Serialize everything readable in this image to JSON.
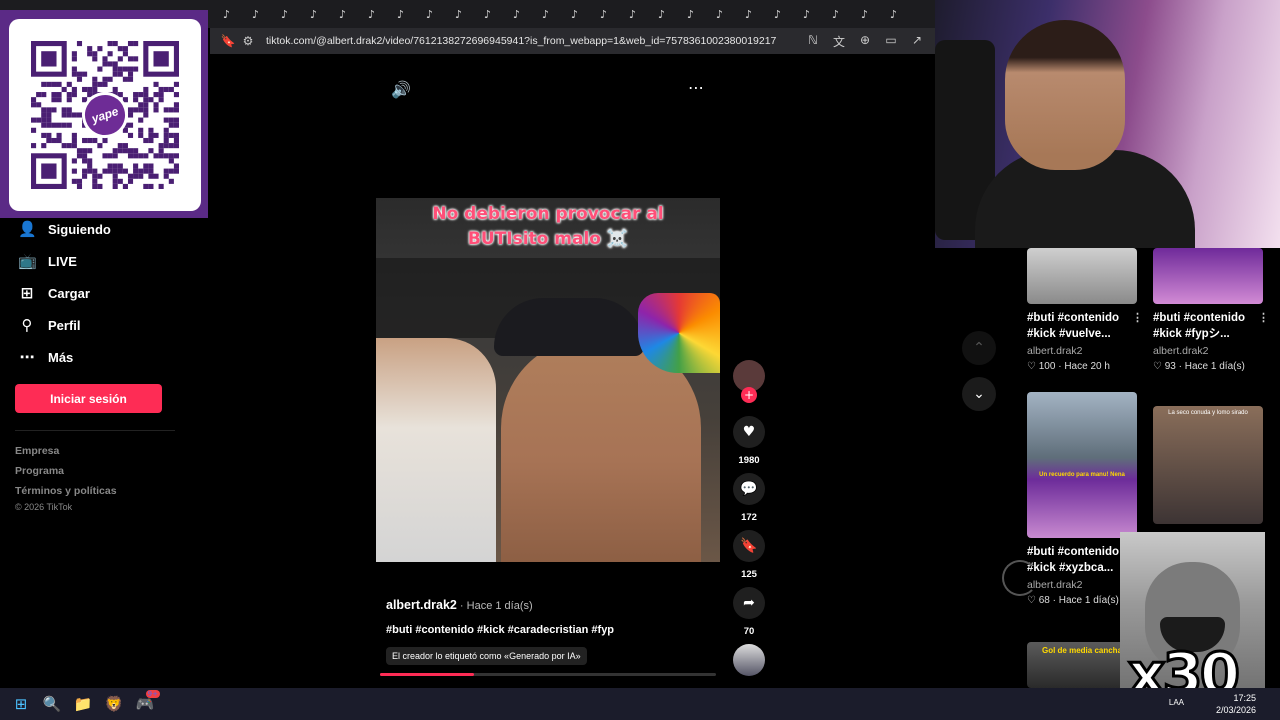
{
  "browser": {
    "url": "tiktok.com/@albert.drak2/video/7612138272696945941?is_from_webapp=1&web_id=7578361002380019217",
    "tab_icon": "tiktok-icon",
    "tab_count": 24
  },
  "qr": {
    "brand": "yape",
    "logo_currency": "S/"
  },
  "sidebar": {
    "items": [
      {
        "label": "Siguiendo",
        "icon": "following-icon"
      },
      {
        "label": "LIVE",
        "icon": "live-tv-icon"
      },
      {
        "label": "Cargar",
        "icon": "upload-plus-icon"
      },
      {
        "label": "Perfil",
        "icon": "profile-icon"
      },
      {
        "label": "Más",
        "icon": "more-dots-icon"
      }
    ],
    "login_button": "Iniciar sesión",
    "footer_links": [
      "Empresa",
      "Programa",
      "Términos y políticas"
    ],
    "copyright": "© 2026 TikTok"
  },
  "video": {
    "caption_line1": "No debieron provocar al",
    "caption_line2": "BUTIsito malo ☠️",
    "author": "albert.drak2",
    "time": " · Hace 1 día(s)",
    "hashtags": "#buti #contenido #kick #caradecristian #fyp",
    "ai_label": "El creador lo etiquetó como «Generado por IA»",
    "progress_fraction": 0.28,
    "likes": "1980",
    "comments": "172",
    "saves": "125",
    "shares": "70"
  },
  "recommendations": [
    {
      "title_line1": "#buti #contenido",
      "title_line2": "#kick #vuelve...",
      "author": "albert.drak2",
      "likes": "100",
      "time": "Hace 20 h"
    },
    {
      "title_line1": "#buti #contenido",
      "title_line2": "#kick #fypシ...",
      "author": "albert.drak2",
      "likes": "93",
      "time": "Hace 1 día(s)"
    },
    {
      "title_line1": "#buti #contenido",
      "title_line2": "#kick #xyzbca...",
      "author": "albert.drak2",
      "likes": "68",
      "time": "Hace 1 día(s)"
    },
    {
      "thumb_text": "Gol de media cancha"
    }
  ],
  "thumb_texts": {
    "card3_banner": "Un recuerdo para manu! Nena",
    "card4_banner": "La seco conuda y lomo sirado"
  },
  "meme": {
    "text": "x30"
  },
  "taskbar": {
    "time": "17:25",
    "date": "2/03/2026",
    "lang": "LAA",
    "discord_badge": "9+"
  },
  "colors": {
    "accent": "#fe2c55",
    "yape_purple": "#5b2a86"
  }
}
